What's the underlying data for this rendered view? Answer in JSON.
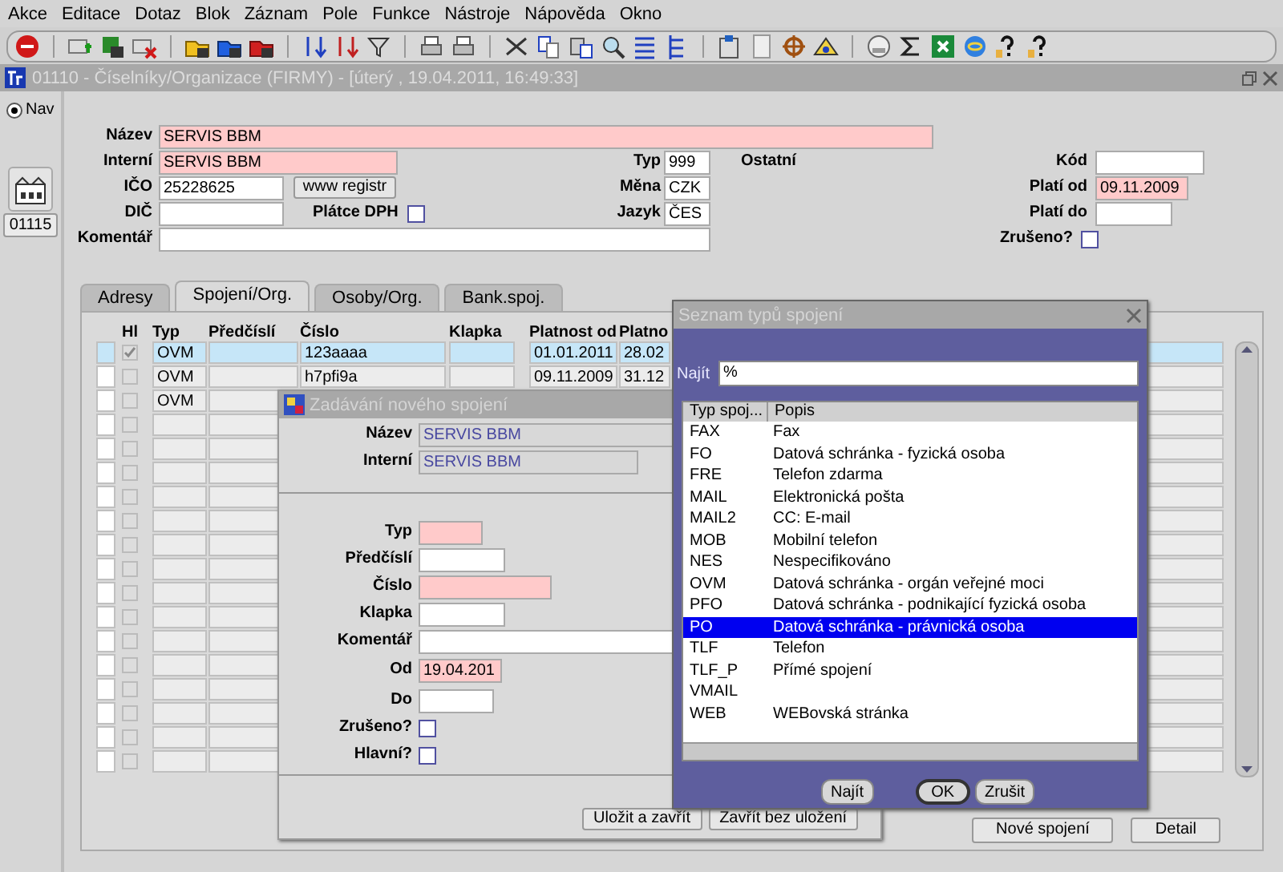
{
  "menu": [
    "Akce",
    "Editace",
    "Dotaz",
    "Blok",
    "Záznam",
    "Pole",
    "Funkce",
    "Nástroje",
    "Nápověda",
    "Okno"
  ],
  "window": {
    "title": "01110 - Číselníky/Organizace (FIRMY) - [úterý , 19.04.2011, 16:49:33]"
  },
  "nav": {
    "label": "Nav",
    "selected": true
  },
  "record_number": "01115",
  "form": {
    "nazev": {
      "label": "Název",
      "value": "SERVIS BBM",
      "required": true
    },
    "interni": {
      "label": "Interní",
      "value": "SERVIS BBM",
      "required": true
    },
    "ico": {
      "label": "IČO",
      "value": "25228625",
      "required": false
    },
    "registry_button": "www registr",
    "dic": {
      "label": "DIČ",
      "required": false
    },
    "platce_dph": {
      "label": "Plátce DPH",
      "checked": false
    },
    "komentar": {
      "label": "Komentář",
      "required": false
    },
    "typ": {
      "label": "Typ",
      "value": "999",
      "required": false
    },
    "typ_name": "Ostatní",
    "mena": {
      "label": "Měna",
      "value": "CZK",
      "required": false
    },
    "jazyk": {
      "label": "Jazyk",
      "value": "ČES",
      "required": false
    },
    "kod": {
      "label": "Kód",
      "required": false
    },
    "plati_od": {
      "label": "Platí od",
      "value": "09.11.2009",
      "required": true
    },
    "plati_do": {
      "label": "Platí do",
      "required": false
    },
    "zruseno": {
      "label": "Zrušeno?",
      "checked": false
    }
  },
  "tabs": [
    {
      "label": "Adresy",
      "selected": false
    },
    {
      "label": "Spojení/Org.",
      "selected": true
    },
    {
      "label": "Osoby/Org.",
      "selected": false
    },
    {
      "label": "Bank.spoj.",
      "selected": false
    }
  ],
  "table": {
    "columns": [
      "Hl",
      "Typ",
      "Předčíslí",
      "Číslo",
      "Klapka",
      "Platnost od",
      "Platno"
    ],
    "rows": [
      {
        "selected": true,
        "hl_checked": true,
        "typ": "OVM",
        "cislo": "123aaaa",
        "platnost_od": "01.01.2011",
        "platnost_do": "28.02"
      },
      {
        "selected": false,
        "hl_checked": false,
        "typ": "OVM",
        "cislo": "h7pfi9a",
        "platnost_od": "09.11.2009",
        "platnost_do": "31.12"
      },
      {
        "selected": false,
        "hl_checked": false,
        "typ": "OVM"
      },
      {
        "selected": false,
        "hl_checked": false
      },
      {
        "selected": false,
        "hl_checked": false
      },
      {
        "selected": false,
        "hl_checked": false
      },
      {
        "selected": false,
        "hl_checked": false
      },
      {
        "selected": false,
        "hl_checked": false
      },
      {
        "selected": false,
        "hl_checked": false
      },
      {
        "selected": false,
        "hl_checked": false
      },
      {
        "selected": false,
        "hl_checked": false
      },
      {
        "selected": false,
        "hl_checked": false
      },
      {
        "selected": false,
        "hl_checked": false
      },
      {
        "selected": false,
        "hl_checked": false
      },
      {
        "selected": false,
        "hl_checked": false
      },
      {
        "selected": false,
        "hl_checked": false
      },
      {
        "selected": false,
        "hl_checked": false
      },
      {
        "selected": false,
        "hl_checked": false
      }
    ]
  },
  "buttons": [
    "Nové spojení",
    "Detail"
  ],
  "new_connection_dialog": {
    "title": "Zadávání nového spojení",
    "fields": [
      {
        "kind": "readonly",
        "label": "Název",
        "value": "SERVIS BBM"
      },
      {
        "kind": "readonly",
        "label": "Interní",
        "value": "SERVIS BBM"
      },
      {
        "kind": "text",
        "label": "Typ",
        "required": true
      },
      {
        "kind": "text",
        "label": "Předčíslí",
        "required": false
      },
      {
        "kind": "text",
        "label": "Číslo",
        "required": true
      },
      {
        "kind": "text",
        "label": "Klapka",
        "required": false
      },
      {
        "kind": "text",
        "label": "Komentář",
        "required": false
      },
      {
        "kind": "text",
        "label": "Od",
        "value": "19.04.201",
        "required": true
      },
      {
        "kind": "text",
        "label": "Do",
        "required": false
      },
      {
        "kind": "checkbox",
        "label": "Zrušeno?",
        "checked": false
      },
      {
        "kind": "checkbox",
        "label": "Hlavní?",
        "checked": false
      }
    ],
    "buttons": [
      "Uložit a zavřít",
      "Zavřít bez uložení"
    ]
  },
  "type_list_dialog": {
    "title": "Seznam typů spojení",
    "search_label": "Najít",
    "search_value": "%",
    "columns": [
      "Typ spoj...",
      "Popis"
    ],
    "rows": [
      {
        "code": "FAX",
        "description": "Fax",
        "selected": false
      },
      {
        "code": "FO",
        "description": "Datová schránka - fyzická osoba",
        "selected": false
      },
      {
        "code": "FRE",
        "description": "Telefon zdarma",
        "selected": false
      },
      {
        "code": "MAIL",
        "description": "Elektronická pošta",
        "selected": false
      },
      {
        "code": "MAIL2",
        "description": "CC: E-mail",
        "selected": false
      },
      {
        "code": "MOB",
        "description": "Mobilní telefon",
        "selected": false
      },
      {
        "code": "NES",
        "description": "Nespecifikováno",
        "selected": false
      },
      {
        "code": "OVM",
        "description": "Datová schránka - orgán veřejné moci",
        "selected": false
      },
      {
        "code": "PFO",
        "description": "Datová schránka - podnikající fyzická osoba",
        "selected": false
      },
      {
        "code": "PO",
        "description": "Datová schránka - právnická osoba",
        "selected": true
      },
      {
        "code": "TLF",
        "description": "Telefon",
        "selected": false
      },
      {
        "code": "TLF_P",
        "description": "Přímé spojení",
        "selected": false
      },
      {
        "code": "VMAIL",
        "selected": false
      },
      {
        "code": "WEB",
        "description": "WEBovská stránka",
        "selected": false
      }
    ],
    "buttons": [
      {
        "label": "Najít",
        "default": false
      },
      {
        "label": "OK",
        "default": true
      },
      {
        "label": "Zrušit",
        "default": false
      }
    ]
  }
}
